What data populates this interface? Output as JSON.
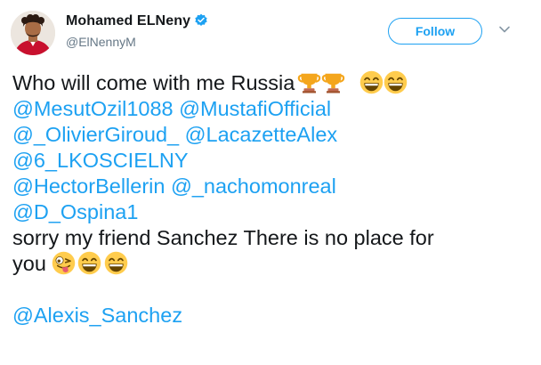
{
  "author": {
    "display_name": "Mohamed ELNeny",
    "handle": "@ElNennyM",
    "verified": true
  },
  "follow_button": {
    "label": "Follow"
  },
  "icons": {
    "verified": "verified-badge-icon",
    "menu": "chevron-down-icon",
    "emojis": [
      "trophy",
      "grinning-face-with-smiling-eyes",
      "winking-face-with-tongue"
    ]
  },
  "colors": {
    "link": "#1da1f2",
    "text": "#14171a",
    "muted": "#657786"
  },
  "tweet": {
    "line1": "Who will come with me Russia",
    "mentions_1": [
      "@MesutOzil1088",
      "@MustafiOfficial"
    ],
    "mentions_2": [
      "@_OlivierGiroud_",
      "@LacazetteAlex"
    ],
    "mentions_3": [
      "@6_LKOSCIELNY"
    ],
    "mentions_4": [
      "@HectorBellerin",
      "@_nachomonreal"
    ],
    "mentions_5": [
      "@D_Ospina1"
    ],
    "line7": "sorry my friend Sanchez There is no place for",
    "line8": "you",
    "final_mention": "@Alexis_Sanchez"
  }
}
